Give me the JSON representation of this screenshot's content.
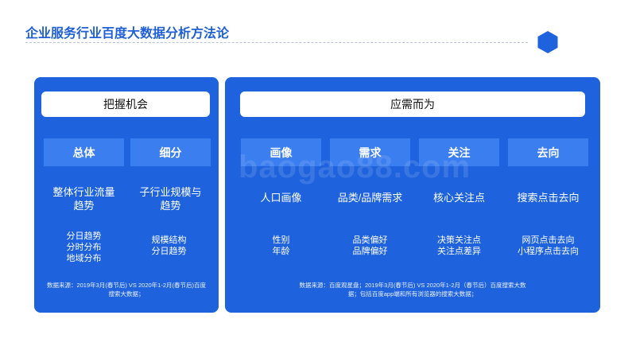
{
  "header": {
    "title": "企业服务行业百度大数据分析方法论"
  },
  "watermark": "baogao88.com",
  "left_panel": {
    "heading": "把握机会",
    "columns": [
      {
        "category": "总体",
        "summary": [
          "整体行业流量",
          "趋势"
        ],
        "details": [
          "分日趋势",
          "分时分布",
          "地域分布"
        ]
      },
      {
        "category": "细分",
        "summary": [
          "子行业规模与",
          "趋势"
        ],
        "details": [
          "规模结构",
          "分日趋势"
        ]
      }
    ],
    "source": [
      "数据来源：2019年3月(春节后) VS 2020年1-2月(春节后)百度",
      "搜索大数据；"
    ]
  },
  "right_panel": {
    "heading": "应需而为",
    "columns": [
      {
        "category": "画像",
        "summary": [
          "人口画像"
        ],
        "details": [
          "性别",
          "年龄"
        ]
      },
      {
        "category": "需求",
        "summary": [
          "品类/品牌需求"
        ],
        "details": [
          "品类偏好",
          "品牌偏好"
        ]
      },
      {
        "category": "关注",
        "summary": [
          "核心关注点"
        ],
        "details": [
          "决策关注点",
          "关注点差异"
        ]
      },
      {
        "category": "去向",
        "summary": [
          "搜索点击去向"
        ],
        "details": [
          "网页点击去向",
          "小程序点击去向"
        ]
      }
    ],
    "source": [
      "数据来源：百度观星盘；2019年3月(春节后) VS 2020年1-2月（春节后）百度搜索大数",
      "据；包括百度app端和所有浏览器的搜索大数据；"
    ]
  },
  "colors": {
    "title": "#1f5fd6",
    "panel": "#1e63dd",
    "tile": "#3a7ef0",
    "hexagon": "#1e63dd"
  }
}
